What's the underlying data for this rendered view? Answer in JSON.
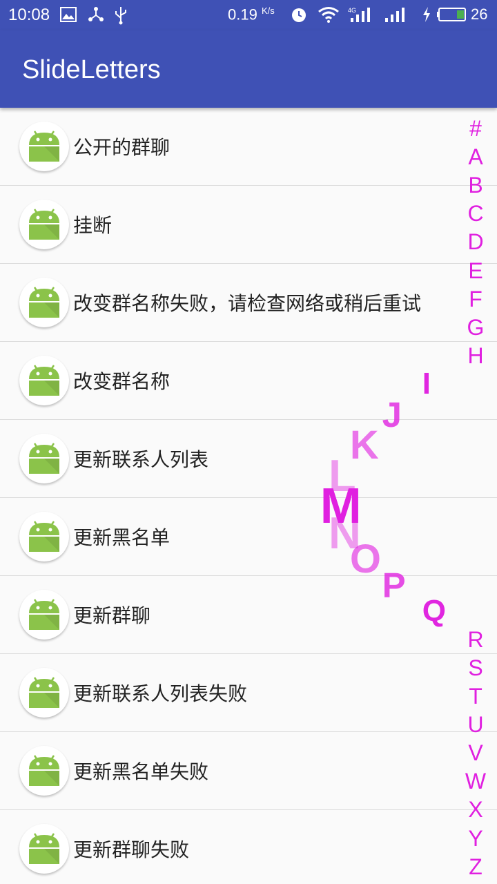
{
  "status_bar": {
    "time": "10:08",
    "speed_value": "0.19",
    "speed_unit": "K/s",
    "network_label": "4G",
    "battery_level": "26",
    "icons": [
      "image-icon",
      "share-icon",
      "usb-icon",
      "alarm-icon",
      "wifi-icon",
      "signal-icon",
      "signal-icon",
      "charging-icon",
      "battery-icon"
    ]
  },
  "app_bar": {
    "title": "SlideLetters"
  },
  "list": {
    "items": [
      {
        "label": "公开的群聊"
      },
      {
        "label": "挂断"
      },
      {
        "label": "改变群名称失败，请检查网络或稍后重试"
      },
      {
        "label": "改变群名称"
      },
      {
        "label": "更新联系人列表"
      },
      {
        "label": "更新黑名单"
      },
      {
        "label": "更新群聊"
      },
      {
        "label": "更新联系人列表失败"
      },
      {
        "label": "更新黑名单失败"
      },
      {
        "label": "更新群聊失败"
      }
    ]
  },
  "index_bar": {
    "letters": [
      "#",
      "A",
      "B",
      "C",
      "D",
      "E",
      "F",
      "G",
      "H",
      "I",
      "J",
      "K",
      "L",
      "M",
      "N",
      "O",
      "P",
      "Q",
      "R",
      "S",
      "T",
      "U",
      "V",
      "W",
      "X",
      "Y",
      "Z"
    ],
    "selected": "M",
    "accent_color": "#e020e0"
  },
  "colors": {
    "primary": "#3f51b5",
    "android_green": "#8bc34a"
  }
}
